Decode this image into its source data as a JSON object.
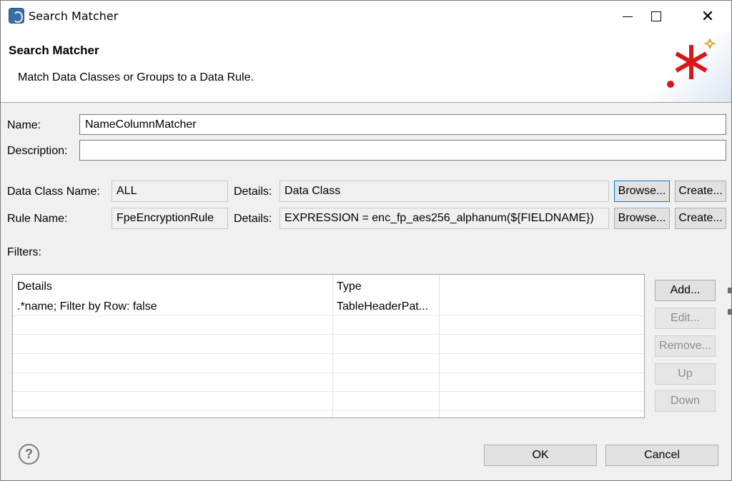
{
  "window": {
    "title": "Search Matcher",
    "app_icon": "eclipse-app-icon",
    "close_glyph": "✕"
  },
  "banner": {
    "title": "Search Matcher",
    "description": "Match Data Classes or Groups to a Data Rule.",
    "graphic_icon": "regex-asterisk-icon"
  },
  "form": {
    "name_label": "Name:",
    "name_value": "NameColumnMatcher",
    "description_label": "Description:",
    "description_value": "",
    "data_class_label": "Data Class Name:",
    "data_class_value": "ALL",
    "data_class_details_label": "Details:",
    "data_class_details_value": "Data Class",
    "rule_label": "Rule Name:",
    "rule_value": "FpeEncryptionRule",
    "rule_details_label": "Details:",
    "rule_details_value": "EXPRESSION = enc_fp_aes256_alphanum(${FIELDNAME})",
    "browse_label": "Browse...",
    "create_label": "Create..."
  },
  "filters": {
    "label": "Filters:",
    "columns": [
      "Details",
      "Type"
    ],
    "rows": [
      [
        ".*name; Filter by Row: false",
        "TableHeaderPat..."
      ]
    ],
    "buttons": {
      "add": "Add...",
      "edit": "Edit...",
      "remove": "Remove...",
      "up": "Up",
      "down": "Down"
    }
  },
  "footer": {
    "help_glyph": "?",
    "ok": "OK",
    "cancel": "Cancel"
  },
  "colors": {
    "accent_focus": "#0078d7",
    "asterisk_red": "#d9161c",
    "dot_red": "#d9161c",
    "sparkle_gold": "#d9a93a"
  }
}
